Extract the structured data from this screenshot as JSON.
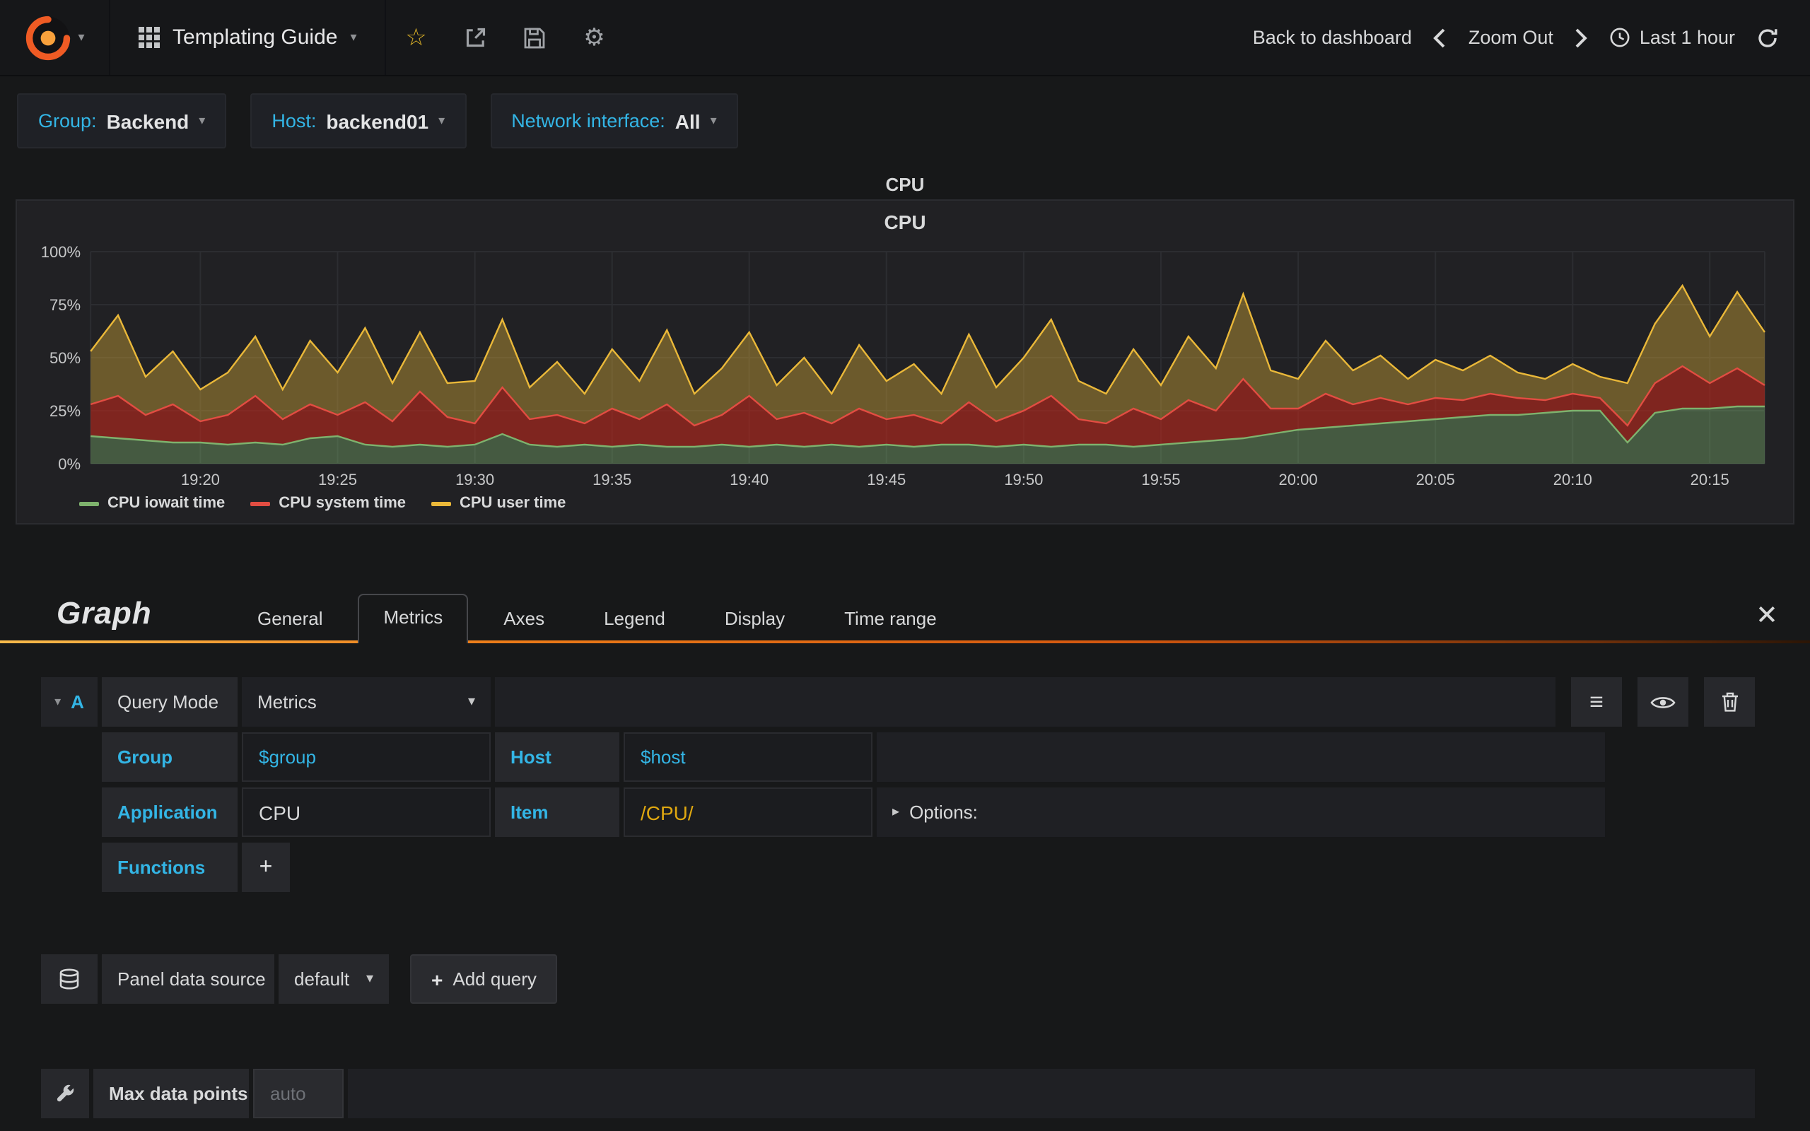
{
  "icons": {
    "caret_down": "▾",
    "caret_right": "▸",
    "star": "☆",
    "gear": "⚙",
    "menu": "≡",
    "plus": "+"
  },
  "navbar": {
    "dashboard_title": "Templating Guide",
    "back_to_dashboard": "Back to dashboard",
    "zoom_out": "Zoom Out",
    "time_range": "Last 1 hour"
  },
  "template_variables": [
    {
      "label": "Group:",
      "value": "Backend"
    },
    {
      "label": "Host:",
      "value": "backend01"
    },
    {
      "label": "Network interface:",
      "value": "All"
    }
  ],
  "panel": {
    "title": "CPU",
    "graph_title": "CPU"
  },
  "chart_data": {
    "type": "area",
    "stacked": true,
    "title": "CPU",
    "x_start": "19:16",
    "x_step_minutes": 1,
    "ylim": [
      0,
      100
    ],
    "y_ticks": [
      0,
      25,
      50,
      75,
      100
    ],
    "y_tick_labels": [
      "0%",
      "25%",
      "50%",
      "75%",
      "100%"
    ],
    "x_ticks": [
      {
        "label": "19:20",
        "i": 4
      },
      {
        "label": "19:25",
        "i": 9
      },
      {
        "label": "19:30",
        "i": 14
      },
      {
        "label": "19:35",
        "i": 19
      },
      {
        "label": "19:40",
        "i": 24
      },
      {
        "label": "19:45",
        "i": 29
      },
      {
        "label": "19:50",
        "i": 34
      },
      {
        "label": "19:55",
        "i": 39
      },
      {
        "label": "20:00",
        "i": 44
      },
      {
        "label": "20:05",
        "i": 49
      },
      {
        "label": "20:10",
        "i": 54
      },
      {
        "label": "20:15",
        "i": 59
      }
    ],
    "legend_position": "bottom",
    "grid": true,
    "series": [
      {
        "name": "CPU iowait time",
        "color": "#7eb26d",
        "fill": "rgba(126,178,109,0.40)",
        "values": [
          13,
          12,
          11,
          10,
          10,
          9,
          10,
          9,
          12,
          13,
          9,
          8,
          9,
          8,
          9,
          14,
          9,
          8,
          9,
          8,
          9,
          8,
          8,
          9,
          8,
          9,
          8,
          9,
          8,
          9,
          8,
          9,
          9,
          8,
          9,
          8,
          9,
          9,
          8,
          9,
          10,
          11,
          12,
          14,
          16,
          17,
          18,
          19,
          20,
          21,
          22,
          23,
          23,
          24,
          25,
          25,
          10,
          24,
          26,
          26,
          27,
          27
        ]
      },
      {
        "name": "CPU system time",
        "color": "#e24d42",
        "fill": "rgba(190,40,28,0.60)",
        "values": [
          15,
          20,
          12,
          18,
          10,
          14,
          22,
          12,
          16,
          10,
          20,
          12,
          25,
          14,
          10,
          22,
          12,
          15,
          10,
          18,
          12,
          20,
          10,
          14,
          24,
          12,
          16,
          10,
          18,
          12,
          15,
          10,
          20,
          12,
          16,
          24,
          12,
          10,
          18,
          12,
          20,
          14,
          28,
          12,
          10,
          16,
          10,
          12,
          8,
          10,
          8,
          10,
          8,
          6,
          8,
          6,
          8,
          14,
          20,
          12,
          18,
          10
        ]
      },
      {
        "name": "CPU user time",
        "color": "#eab839",
        "fill": "rgba(200,160,55,0.45)",
        "values": [
          25,
          38,
          18,
          25,
          15,
          20,
          28,
          14,
          30,
          20,
          35,
          18,
          28,
          16,
          20,
          32,
          15,
          25,
          14,
          28,
          18,
          35,
          15,
          22,
          30,
          16,
          26,
          14,
          30,
          18,
          24,
          14,
          32,
          16,
          25,
          36,
          18,
          14,
          28,
          16,
          30,
          20,
          40,
          18,
          14,
          25,
          16,
          20,
          12,
          18,
          14,
          18,
          12,
          10,
          14,
          10,
          20,
          28,
          38,
          22,
          36,
          25
        ]
      }
    ]
  },
  "editor": {
    "panel_type": "Graph",
    "tabs": [
      "General",
      "Metrics",
      "Axes",
      "Legend",
      "Display",
      "Time range"
    ],
    "active_tab": "Metrics",
    "query": {
      "letter": "A",
      "query_mode_label": "Query Mode",
      "query_mode_value": "Metrics",
      "group_label": "Group",
      "group_value": "$group",
      "host_label": "Host",
      "host_value": "$host",
      "application_label": "Application",
      "application_value": "CPU",
      "item_label": "Item",
      "item_value": "/CPU/",
      "options_label": "Options:",
      "functions_label": "Functions"
    },
    "datasource": {
      "label": "Panel data source",
      "value": "default",
      "add_query_label": "Add query"
    },
    "max_data_points": {
      "label": "Max data points",
      "placeholder": "auto"
    }
  }
}
